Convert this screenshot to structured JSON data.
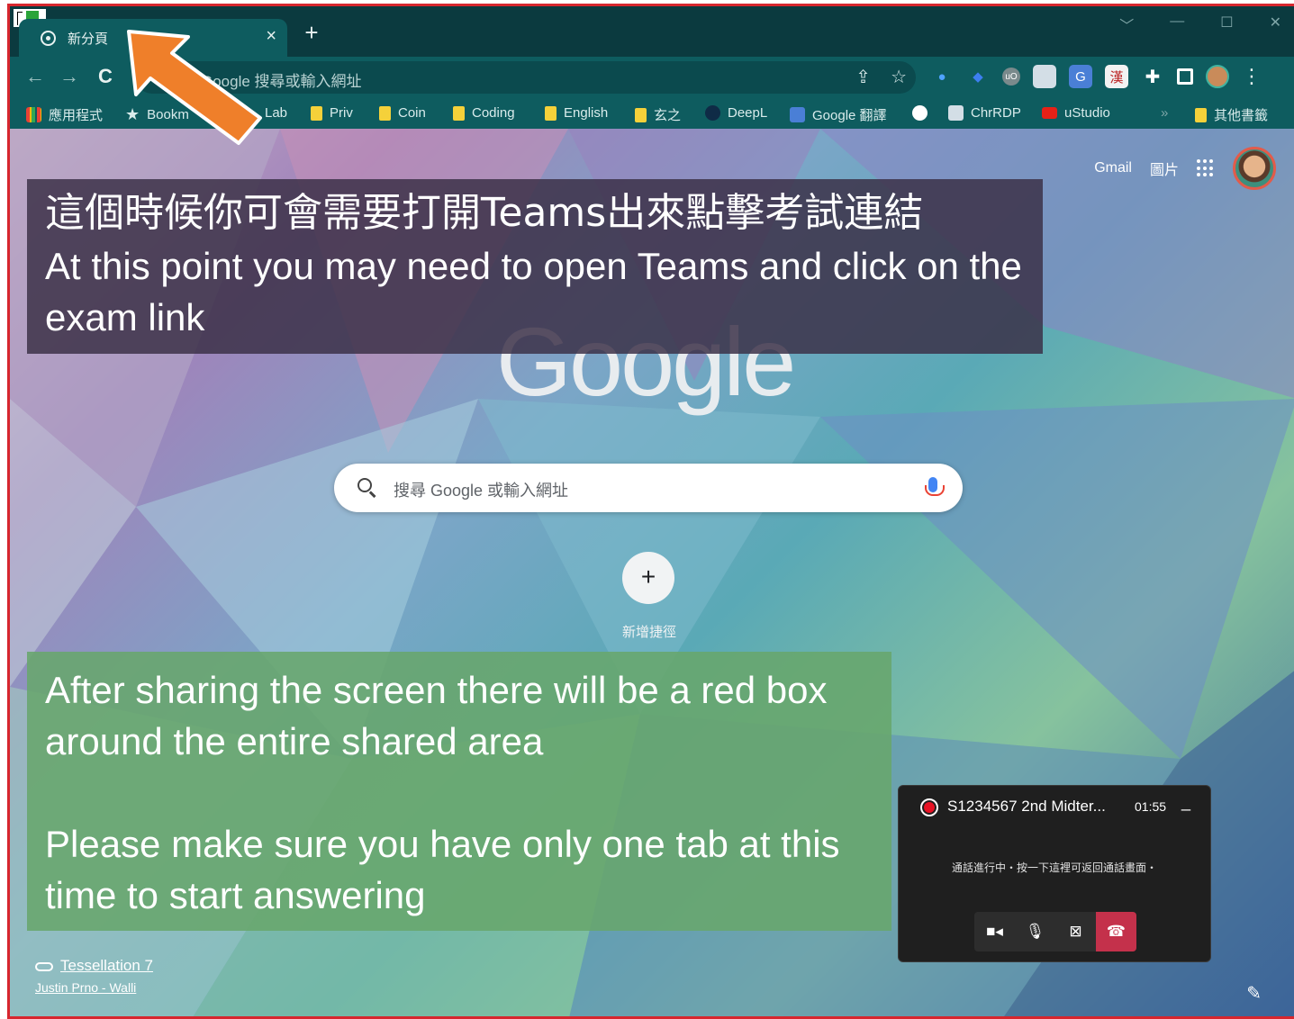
{
  "browser": {
    "tab": {
      "title": "新分頁",
      "close": "×"
    },
    "new_tab": "+",
    "window_controls": [
      "﹀",
      "—",
      "☐",
      "✕"
    ],
    "nav": {
      "back": "←",
      "forward": "→",
      "reload": "C"
    },
    "omnibox": {
      "placeholder": "Google 搜尋或輸入網址",
      "icons": [
        "share-icon",
        "star-icon"
      ]
    },
    "extensions": [
      "location-pin",
      "shield-blue",
      "ublock",
      "chrome-remote",
      "google-translate",
      "kanji-app",
      "puzzle",
      "sidepanel"
    ],
    "menu": "⋮"
  },
  "bookmarks": [
    {
      "label": "應用程式",
      "icon": "apps-grid"
    },
    {
      "label": "Bookm",
      "icon": "star"
    },
    {
      "label": "Lab",
      "icon": "folder"
    },
    {
      "label": "Priv",
      "icon": "folder"
    },
    {
      "label": "Coin",
      "icon": "folder"
    },
    {
      "label": "Coding",
      "icon": "folder"
    },
    {
      "label": "English",
      "icon": "folder"
    },
    {
      "label": "玄之",
      "icon": "folder"
    },
    {
      "label": "DeepL",
      "icon": "deepl"
    },
    {
      "label": "Google 翻譯",
      "icon": "translate"
    },
    {
      "label": "",
      "icon": "globe"
    },
    {
      "label": "ChrRDP",
      "icon": "remote"
    },
    {
      "label": "uStudio",
      "icon": "youtube"
    }
  ],
  "bookmarks_more": "»",
  "other_bookmarks": "其他書籤",
  "ntp": {
    "top_links": {
      "gmail": "Gmail",
      "images": "圖片"
    },
    "logo": "Google",
    "search_placeholder": "搜尋 Google 或輸入網址",
    "add_shortcut": "+",
    "add_shortcut_label": "新增捷徑",
    "attribution": {
      "photo": "Tessellation 7",
      "author": "Justin Prno - Walli"
    },
    "edit": "✎"
  },
  "overlay_top": {
    "zh": "這個時候你可會需要打開Teams出來點擊考試連結",
    "en": "At this point you may need to open Teams and click on the exam link"
  },
  "overlay_bottom": {
    "line1": "After sharing the screen there will be a red box around the entire shared area",
    "line2": "Please make sure you have only one tab at this time to start answering"
  },
  "call": {
    "title": "S1234567 2nd Midter...",
    "time": "01:55",
    "minimize": "_",
    "message": "通話進行中・按一下這裡可返回通話畫面・",
    "recording_color": "#e81123",
    "hangup_color": "#c4314b"
  },
  "colors": {
    "share_border": "#d7262e",
    "arrow": "#ef7f2a",
    "chrome_teal": "#0e5c5f"
  }
}
